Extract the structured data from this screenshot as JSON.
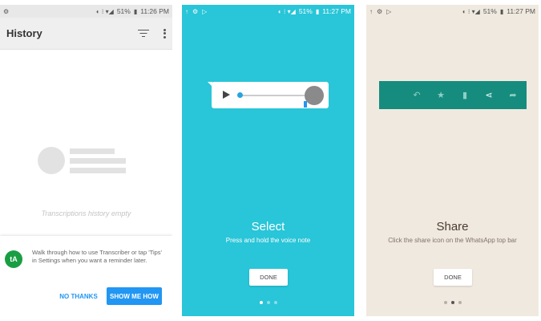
{
  "status_bar": {
    "screen1_time": "11:26 PM",
    "screen2_time": "11:27 PM",
    "screen3_time": "11:27 PM",
    "battery": "51%"
  },
  "screen1": {
    "title": "History",
    "empty_text": "Transcriptions history empty",
    "avatar_initial": "tA",
    "snackbar_text": "Walk through how to use Transcriber or tap 'Tips' in Settings when you want a reminder later.",
    "no_thanks_label": "NO THANKS",
    "show_me_label": "SHOW ME HOW"
  },
  "screen2": {
    "heading": "Select",
    "subtext": "Press and hold the voice note",
    "done_label": "DONE",
    "active_dot": 0
  },
  "screen3": {
    "heading": "Share",
    "subtext": "Click the share icon on the WhatsApp top bar",
    "done_label": "DONE",
    "active_dot": 1
  },
  "colors": {
    "accent_blue": "#2196f3",
    "cyan_bg": "#29c5d8",
    "beige_bg": "#f0e9df",
    "whatsapp_teal": "#168c7e"
  },
  "icons": [
    "settings-icon",
    "play-store-icon",
    "filter-icon",
    "more-icon",
    "play-icon",
    "reply-icon",
    "star-icon",
    "delete-icon",
    "share-icon",
    "forward-icon"
  ]
}
